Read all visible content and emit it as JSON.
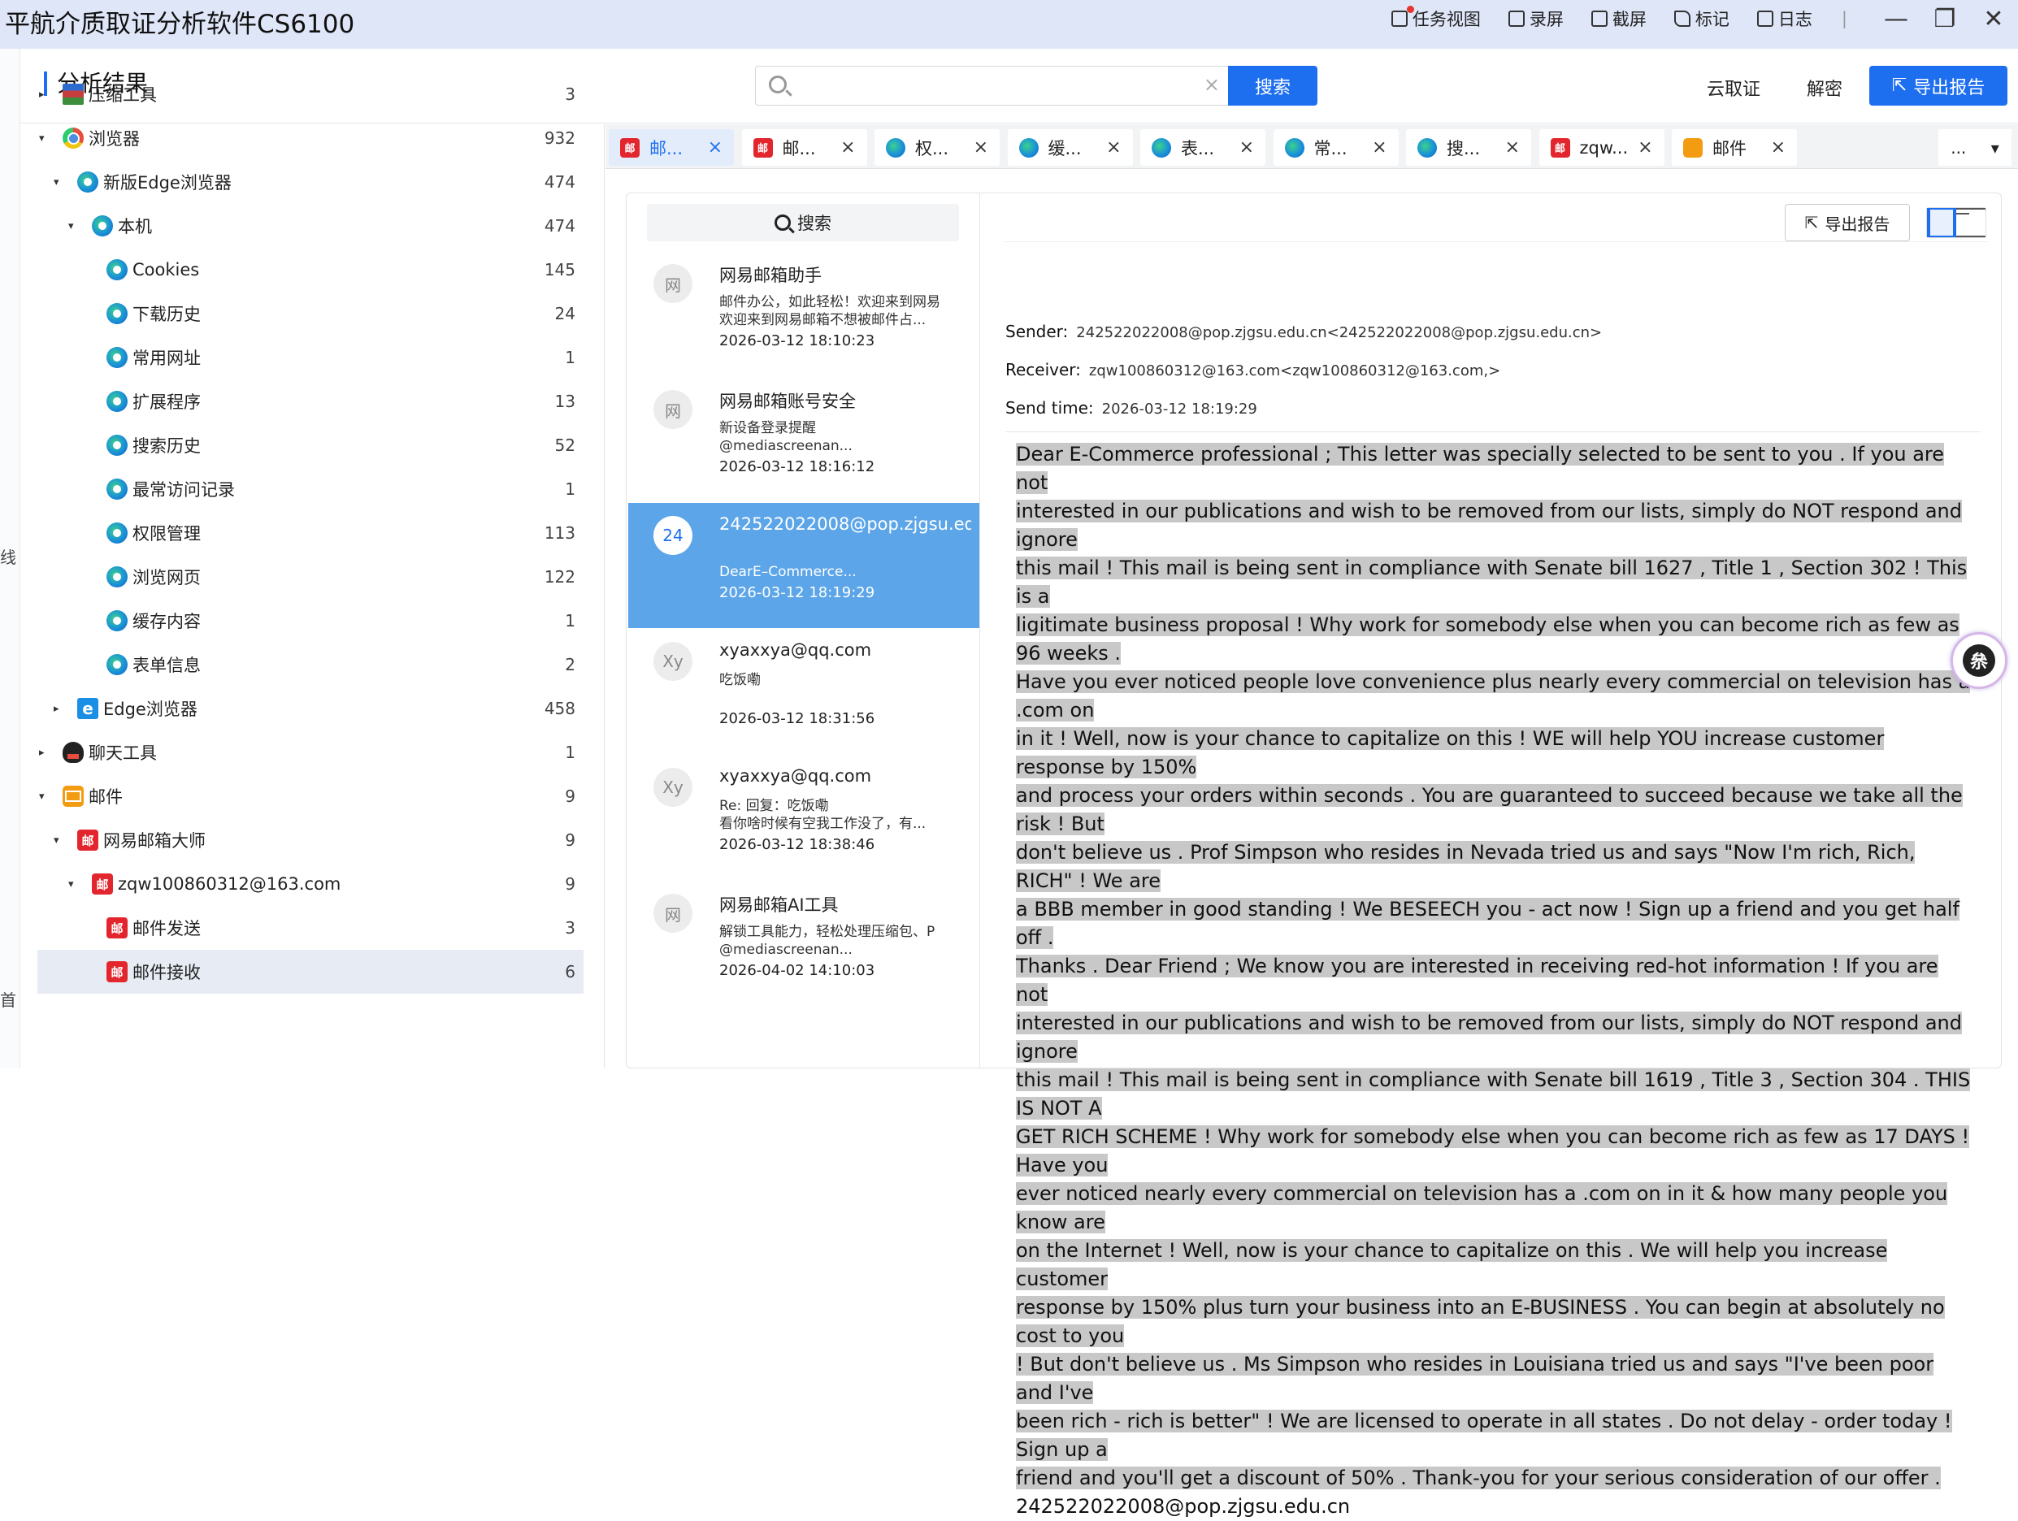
{
  "app_title": "平航介质取证分析软件CS6100",
  "titlebar": {
    "items": [
      {
        "label": "任务视图",
        "icon": "task-view-icon"
      },
      {
        "label": "录屏",
        "icon": "record-screen-icon"
      },
      {
        "label": "截屏",
        "icon": "screenshot-icon"
      },
      {
        "label": "标记",
        "icon": "tag-icon"
      },
      {
        "label": "日志",
        "icon": "log-icon"
      }
    ],
    "divider": "|",
    "minimize": "—",
    "restore": "❐",
    "close": "✕"
  },
  "left_edge": {
    "chars": [
      "线",
      "首"
    ]
  },
  "header": {
    "page_title": "分析结果",
    "search_placeholder": "",
    "search_clear": "×",
    "search_button": "搜索",
    "cloud": "云取证",
    "decrypt": "解密",
    "export": "导出报告"
  },
  "tree": [
    {
      "label": "压缩工具",
      "count": "3",
      "icon": "zip",
      "arrow": "▸"
    },
    {
      "label": "浏览器",
      "count": "932",
      "icon": "chrome",
      "arrow": "▾"
    },
    {
      "label": "新版Edge浏览器",
      "count": "474",
      "icon": "edge",
      "arrow": "▾"
    },
    {
      "label": "本机",
      "count": "474",
      "icon": "edge",
      "arrow": "▾"
    },
    {
      "label": "Cookies",
      "count": "145",
      "icon": "edge",
      "arrow": ""
    },
    {
      "label": "下载历史",
      "count": "24",
      "icon": "edge",
      "arrow": ""
    },
    {
      "label": "常用网址",
      "count": "1",
      "icon": "edge",
      "arrow": ""
    },
    {
      "label": "扩展程序",
      "count": "13",
      "icon": "edge",
      "arrow": ""
    },
    {
      "label": "搜索历史",
      "count": "52",
      "icon": "edge",
      "arrow": ""
    },
    {
      "label": "最常访问记录",
      "count": "1",
      "icon": "edge",
      "arrow": ""
    },
    {
      "label": "权限管理",
      "count": "113",
      "icon": "edge",
      "arrow": ""
    },
    {
      "label": "浏览网页",
      "count": "122",
      "icon": "edge",
      "arrow": ""
    },
    {
      "label": "缓存内容",
      "count": "1",
      "icon": "edge",
      "arrow": ""
    },
    {
      "label": "表单信息",
      "count": "2",
      "icon": "edge",
      "arrow": ""
    },
    {
      "label": "Edge浏览器",
      "count": "458",
      "icon": "eold",
      "arrow": "▸"
    },
    {
      "label": "聊天工具",
      "count": "1",
      "icon": "qq",
      "arrow": "▸"
    },
    {
      "label": "邮件",
      "count": "9",
      "icon": "mailbox",
      "arrow": "▾"
    },
    {
      "label": "网易邮箱大师",
      "count": "9",
      "icon": "mail163",
      "arrow": "▾"
    },
    {
      "label": "zqw100860312@163.com",
      "count": "9",
      "icon": "mail163",
      "arrow": "▾"
    },
    {
      "label": "邮件发送",
      "count": "3",
      "icon": "mail163",
      "arrow": ""
    },
    {
      "label": "邮件接收",
      "count": "6",
      "icon": "mail163",
      "arrow": "",
      "selected": true
    }
  ],
  "mail163_glyph": "邮",
  "edge_old_glyph": "e",
  "tabs": [
    {
      "label": "邮...",
      "icon": "m",
      "active": true
    },
    {
      "label": "邮...",
      "icon": "m"
    },
    {
      "label": "权...",
      "icon": "e"
    },
    {
      "label": "缓...",
      "icon": "e"
    },
    {
      "label": "表...",
      "icon": "e"
    },
    {
      "label": "常...",
      "icon": "e"
    },
    {
      "label": "搜...",
      "icon": "e"
    },
    {
      "label": "zqw...",
      "icon": "m"
    },
    {
      "label": "邮件",
      "icon": "b"
    }
  ],
  "tab_close": "×",
  "tab_more": {
    "dots": "...",
    "caret": "▾"
  },
  "mail_list": {
    "search_label": "搜索",
    "items": [
      {
        "avatar": "网",
        "sender": "网易邮箱助手",
        "snippet": [
          "邮件办公，如此轻松！欢迎来到网易",
          "欢迎来到网易邮箱不想被邮件占..."
        ],
        "date": "2026-03-12 18:10:23"
      },
      {
        "avatar": "网",
        "sender": "网易邮箱账号安全",
        "snippet": [
          "新设备登录提醒",
          "@mediascreenan..."
        ],
        "date": "2026-03-12 18:16:12"
      },
      {
        "avatar": "24",
        "sender": "242522022008@pop.zjgsu.edu.cn",
        "snippet": [
          "",
          "DearE–Commerce..."
        ],
        "date": "2026-03-12 18:19:29",
        "selected": true
      },
      {
        "avatar": "Xy",
        "sender": "xyaxxya@qq.com",
        "snippet": [
          "吃饭嘞",
          ""
        ],
        "date": "2026-03-12 18:31:56"
      },
      {
        "avatar": "Xy",
        "sender": "xyaxxya@qq.com",
        "snippet": [
          "Re: 回复：吃饭嘞",
          "看你啥时候有空我工作没了，有..."
        ],
        "date": "2026-03-12 18:38:46"
      },
      {
        "avatar": "网",
        "sender": "网易邮箱AI工具",
        "snippet": [
          "解锁工具能力，轻松处理压缩包、P",
          "@mediascreenan..."
        ],
        "date": "2026-04-02 14:10:03"
      }
    ]
  },
  "detail": {
    "export": "导出报告",
    "sender_label": "Sender:",
    "sender_value": "242522022008@pop.zjgsu.edu.cn<242522022008@pop.zjgsu.edu.cn>",
    "receiver_label": "Receiver:",
    "receiver_value": "zqw100860312@163.com<zqw100860312@163.com,>",
    "time_label": "Send time:",
    "time_value": "2026-03-12 18:19:29",
    "body_lines": [
      "Dear E-Commerce professional ; This letter was specially selected to be sent to you . If you are not",
      "interested in our publications and wish to be removed from our lists, simply do NOT respond and ignore",
      "this mail ! This mail is being sent in compliance with Senate bill 1627 , Title 1 , Section 302 ! This is a",
      "ligitimate business proposal ! Why work for somebody else when you can become rich as few as 96 weeks .",
      "Have you ever noticed people love convenience plus nearly every commercial on television has a .com on",
      "in it ! Well, now is your chance to capitalize on this ! WE will help YOU increase customer response by 150%",
      "and process your orders within seconds . You are guaranteed to succeed because we take all the risk ! But",
      "don't believe us . Prof Simpson who resides in Nevada tried us and says \"Now I'm rich, Rich, RICH\" ! We are",
      "a BBB member in good standing ! We BESEECH you - act now ! Sign up a friend and you get half off .",
      "Thanks . Dear Friend ; We know you are interested in receiving red-hot information ! If you are not",
      "interested in our publications and wish to be removed from our lists, simply do NOT respond and ignore",
      "this mail ! This mail is being sent in compliance with Senate bill 1619 , Title 3 , Section 304 . THIS IS NOT A",
      "GET RICH SCHEME ! Why work for somebody else when you can become rich as few as 17 DAYS ! Have you",
      "ever noticed nearly every commercial on television has a .com on in it & how many people you know are",
      "on the Internet ! Well, now is your chance to capitalize on this . We will help you increase customer",
      "response by 150% plus turn your business into an E-BUSINESS . You can begin at absolutely no cost to you",
      "! But don't believe us . Ms Simpson who resides in Louisiana tried us and says \"I've been poor and I've",
      "been rich - rich is better\" ! We are licensed to operate in all states . Do not delay - order today ! Sign up a",
      "friend and you'll get a discount of 50% . Thank-you for your serious consideration of our offer ."
    ],
    "footer_line": "242522022008@pop.zjgsu.edu.cn"
  },
  "float_badge": "㕘"
}
